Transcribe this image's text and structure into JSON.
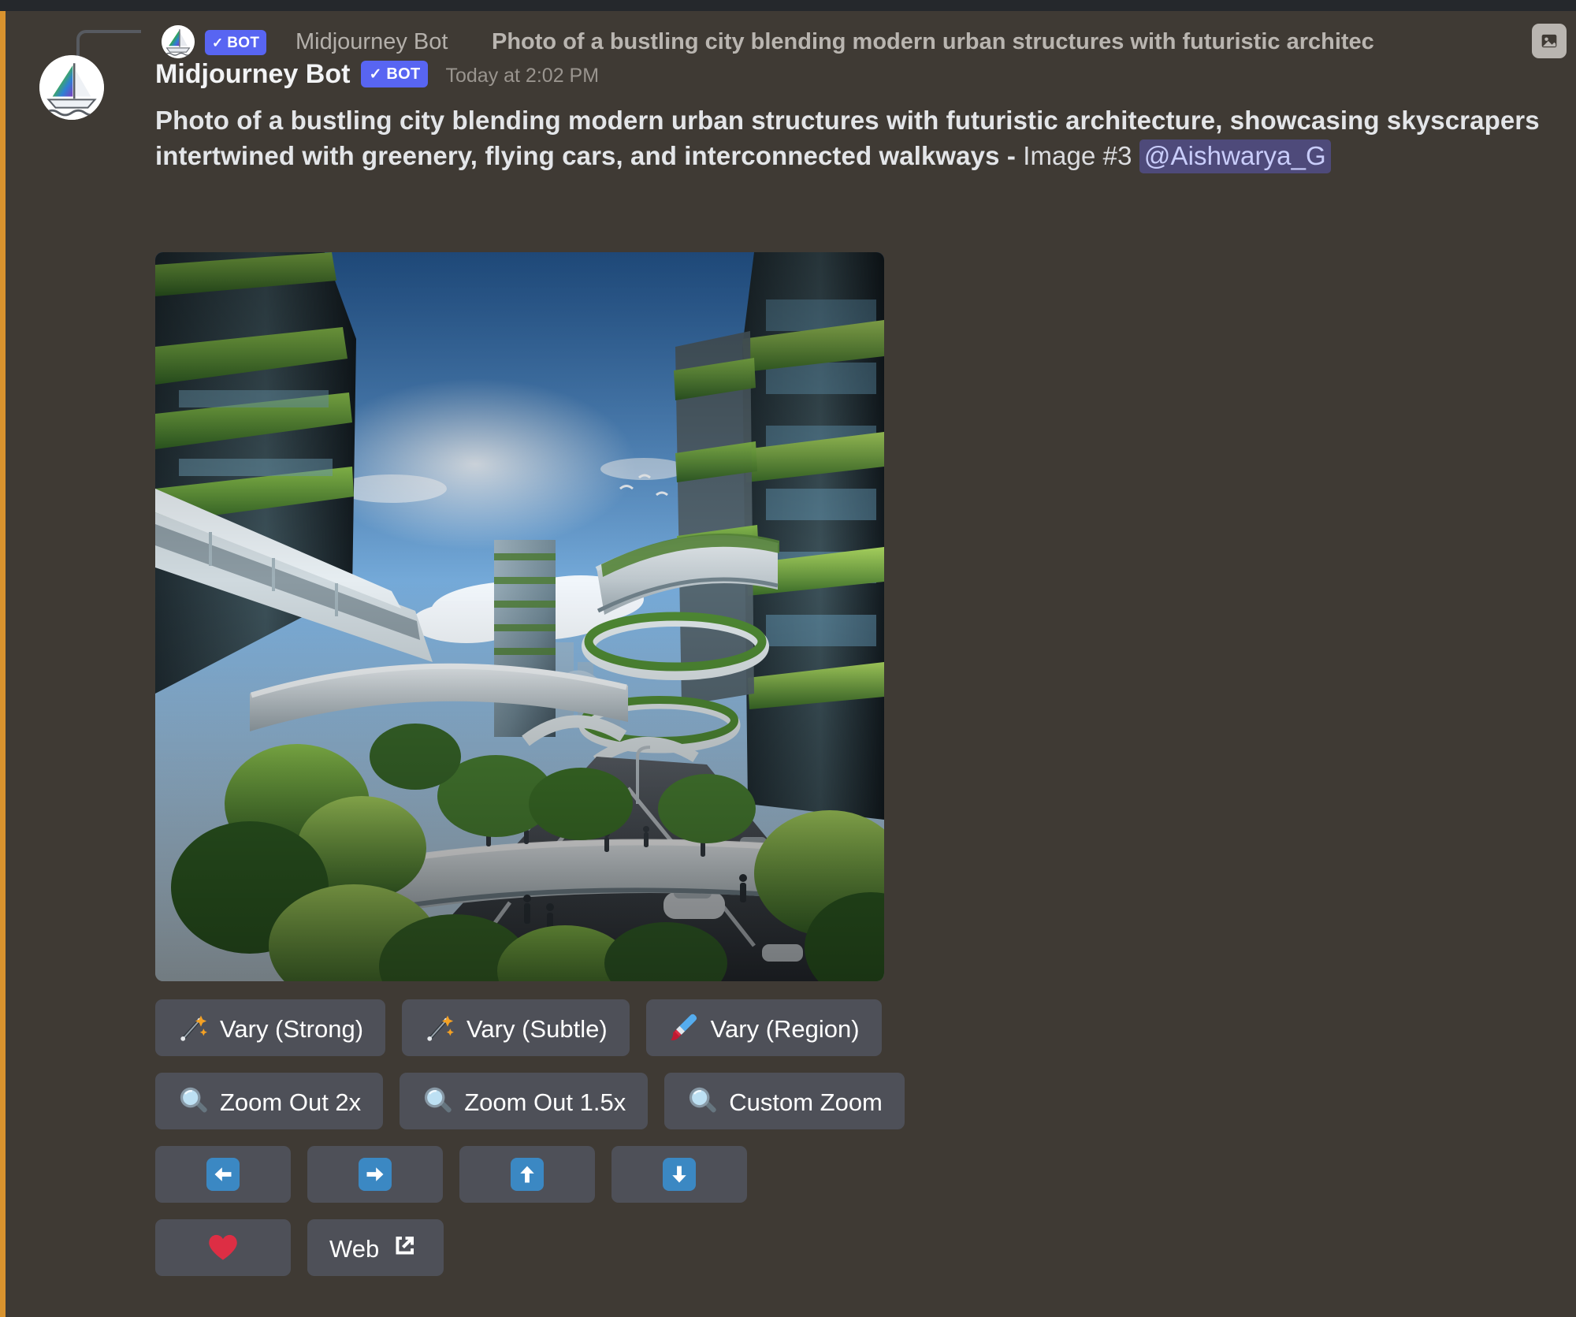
{
  "reply_context": {
    "avatar_icon": "midjourney-sailboat-avatar",
    "bot_badge": "BOT",
    "bot_check": "✓",
    "author": "Midjourney Bot",
    "preview_text": "Photo of a bustling city blending modern urban structures with futuristic architec",
    "attachment_icon": "image-attachment-icon"
  },
  "message": {
    "avatar_icon": "midjourney-sailboat-avatar",
    "author": "Midjourney Bot",
    "bot_badge": "BOT",
    "bot_check": "✓",
    "timestamp": "Today at 2:02 PM",
    "text_line1": "Photo of a bustling city blending modern urban structures with futuristic architecture,",
    "text_line2": "showcasing skyscrapers intertwined with greenery, flying cars, and interconnected walkways -",
    "text_line3": "Image #3",
    "mention": "@Aishwarya_G",
    "attachment_alt": "Futuristic green city with skyscrapers, elevated walkways and trees"
  },
  "components": {
    "rows": [
      [
        {
          "id": "vary-strong",
          "icon": "magic-wand-icon",
          "label": "Vary (Strong)"
        },
        {
          "id": "vary-subtle",
          "icon": "magic-wand-icon",
          "label": "Vary (Subtle)"
        },
        {
          "id": "vary-region",
          "icon": "paintbrush-icon",
          "label": "Vary (Region)"
        }
      ],
      [
        {
          "id": "zoom-out-2x",
          "icon": "magnifying-glass-icon",
          "label": "Zoom Out 2x"
        },
        {
          "id": "zoom-out-1-5x",
          "icon": "magnifying-glass-icon",
          "label": "Zoom Out 1.5x"
        },
        {
          "id": "custom-zoom",
          "icon": "magnifying-glass-icon",
          "label": "Custom Zoom"
        }
      ],
      [
        {
          "id": "pan-left",
          "icon": "arrow-left-icon",
          "label": ""
        },
        {
          "id": "pan-right",
          "icon": "arrow-right-icon",
          "label": ""
        },
        {
          "id": "pan-up",
          "icon": "arrow-up-icon",
          "label": ""
        },
        {
          "id": "pan-down",
          "icon": "arrow-down-icon",
          "label": ""
        }
      ],
      [
        {
          "id": "favorite",
          "icon": "heart-icon",
          "label": ""
        },
        {
          "id": "web",
          "icon": "external-link-icon",
          "label": "Web"
        }
      ]
    ]
  },
  "colors": {
    "page_background": "#3f3a34",
    "top_strip": "#25282c",
    "left_accent": "#d9932e",
    "button_background": "#4e5058",
    "bot_badge": "#5865f2",
    "mention_background": "#4e4a7a",
    "mention_text": "#c9cdfb",
    "heart": "#dd2e44",
    "arrow_tile": "#3b88c3"
  }
}
